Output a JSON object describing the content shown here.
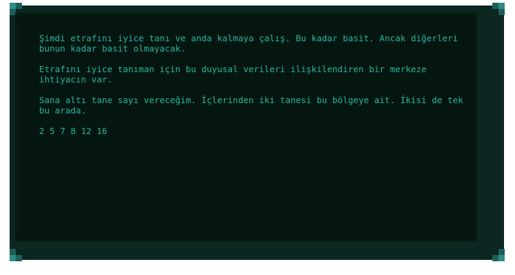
{
  "dialog": {
    "paragraphs": [
      "Şimdi etrafını iyice tanı ve anda kalmaya çalış. Bu kadar basit. Ancak diğerleri bunun kadar basit olmayacak.",
      "Etrafını iyice tanıman için bu duyusal verileri ilişkilendiren bir merkeze ihtiyacın var.",
      "Sana altı tane sayı vereceğim. İçlerinden iki tanesi bu bölgeye ait. İkisi de tek bu arada."
    ],
    "numbers": "2 5 7 8 12 16"
  },
  "colors": {
    "frame": "#0c2621",
    "panel": "#06170f",
    "text": "#27b7a0",
    "corner_light": "#2e8b85",
    "corner_dark": "#1f5f5a"
  }
}
